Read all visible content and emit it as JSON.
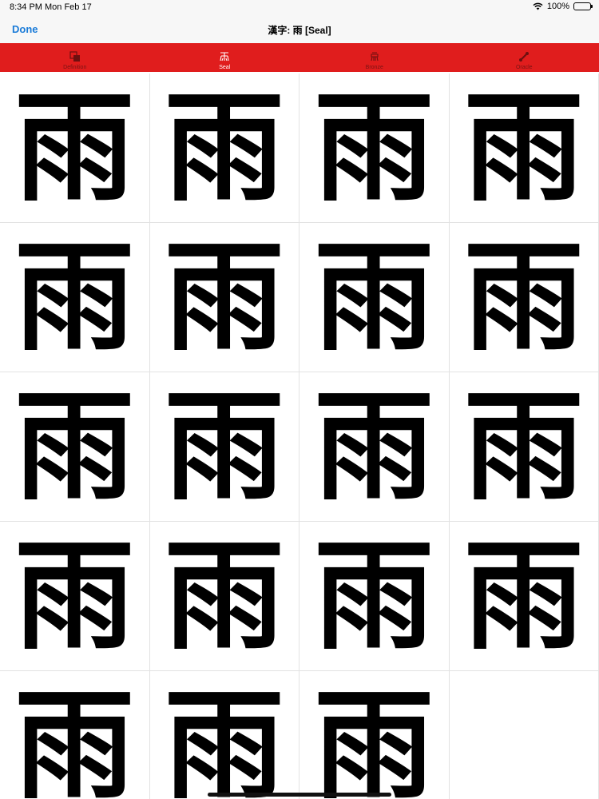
{
  "status": {
    "time": "8:34 PM",
    "date": "Mon Feb 17",
    "battery": "100%",
    "battery_level": 1.0
  },
  "nav": {
    "done_label": "Done",
    "title": "漢字: 雨 [Seal]"
  },
  "tabs": [
    {
      "label": "Definition",
      "icon": "definition-icon",
      "active": false
    },
    {
      "label": "Seal",
      "icon": "seal-icon",
      "active": true
    },
    {
      "label": "Bronze",
      "icon": "bronze-icon",
      "active": false
    },
    {
      "label": "Oracle",
      "icon": "oracle-icon",
      "active": false
    }
  ],
  "colors": {
    "accent": "#e01d1d",
    "link": "#1a7bd8"
  },
  "glyph_tiles": [
    "雨",
    "雨",
    "雨",
    "雨",
    "雨",
    "雨",
    "雨",
    "雨",
    "雨",
    "雨",
    "雨",
    "雨",
    "雨",
    "雨",
    "雨",
    "雨",
    "雨",
    "雨",
    "雨"
  ]
}
